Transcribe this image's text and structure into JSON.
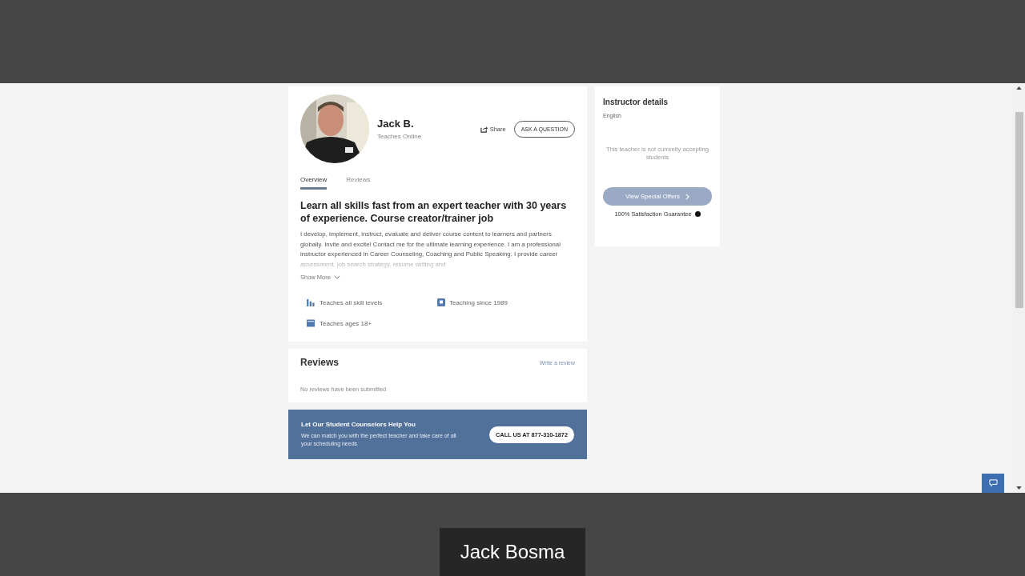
{
  "profile": {
    "name": "Jack B.",
    "subtitle": "Teaches Online",
    "share": "Share",
    "ask_button": "ASK A QUESTION"
  },
  "tabs": [
    {
      "label": "Overview",
      "selected": true
    },
    {
      "label": "Reviews",
      "selected": false
    }
  ],
  "headline": "Learn all skills fast from an expert teacher with 30 years of experience. Course creator/trainer job",
  "description": "I develop, implement, instruct, evaluate and deliver course content to learners and partners globally. Invite and excite! Contact me for the ultimate learning experience. I am a professional instructor experienced in Career Counseling, Coaching and Public Speaking. I provide career assessment, job search strategy, resume writing and",
  "show_more": "Show More",
  "features": [
    {
      "kind": "levels",
      "label": "Teaches all skill levels"
    },
    {
      "kind": "since",
      "label": "Teaching since 1989"
    },
    {
      "kind": "ages",
      "label": "Teaches ages 18+"
    }
  ],
  "reviews": {
    "title": "Reviews",
    "write_link": "Write a review",
    "empty": "No reviews have been submitted"
  },
  "banner": {
    "title": "Let Our Student Counselors Help You",
    "text": "We can match you with the perfect teacher and take care of all your scheduling needs",
    "button": "CALL US AT 877-310-1872"
  },
  "instructor_details": {
    "title": "Instructor details",
    "language": "English",
    "notice": "This teacher is not currently accepting students",
    "offers_button": "View Special Offers",
    "guarantee": "100% Satisfaction Guarantee"
  },
  "participant_name": "Jack Bosma"
}
